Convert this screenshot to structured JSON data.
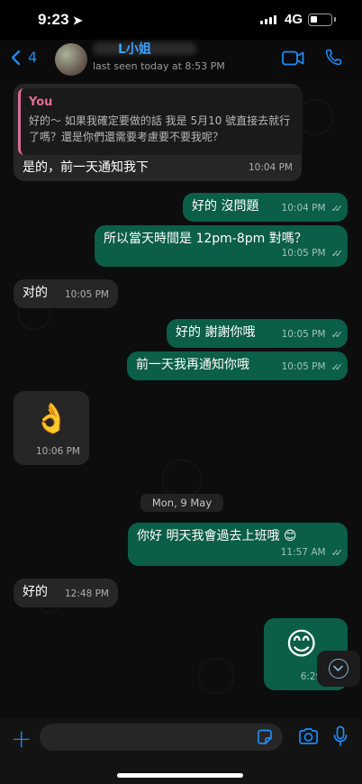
{
  "status": {
    "time": "9:23",
    "network": "4G",
    "battery_level": 0.35
  },
  "header": {
    "back_count": "4",
    "contact_name": "L小姐",
    "last_seen": "last seen today at 8:53 PM"
  },
  "messages": [
    {
      "dir": "in",
      "quote_author": "You",
      "quote_text_1": "好的～ 如果我確定要做的話 我是 5月10 號直接去就行",
      "quote_text_2": "了嗎？還是你們還需要考慮要不要我呢？",
      "text": "是的，前一天通知我下",
      "time": "10:04 PM"
    },
    {
      "dir": "out",
      "text": "好的 沒問題",
      "time": "10:04 PM"
    },
    {
      "dir": "out",
      "text": "所以當天時間是 12pm-8pm 對嗎？",
      "time": "10:05 PM"
    },
    {
      "dir": "in",
      "text": "对的",
      "time": "10:05 PM"
    },
    {
      "dir": "out",
      "text": "好的 謝謝你哦",
      "time": "10:05 PM"
    },
    {
      "dir": "out",
      "text": "前一天我再通知你哦",
      "time": "10:05 PM"
    },
    {
      "dir": "in",
      "text": "👌",
      "time": "10:06 PM"
    },
    {
      "dir": "out",
      "text": "你好 明天我會過去上班哦 😊",
      "time": "11:57 AM"
    },
    {
      "dir": "in",
      "text": "好的",
      "time": "12:48 PM"
    },
    {
      "dir": "out",
      "text": "😊",
      "time": "6:29 PM"
    }
  ],
  "date_divider": "Mon, 9 May",
  "composer": {
    "placeholder": ""
  },
  "colors": {
    "accent": "#1d8cf8",
    "outgoing": "#0b5e47",
    "incoming": "#262626",
    "quote_accent": "#e16b9a"
  }
}
